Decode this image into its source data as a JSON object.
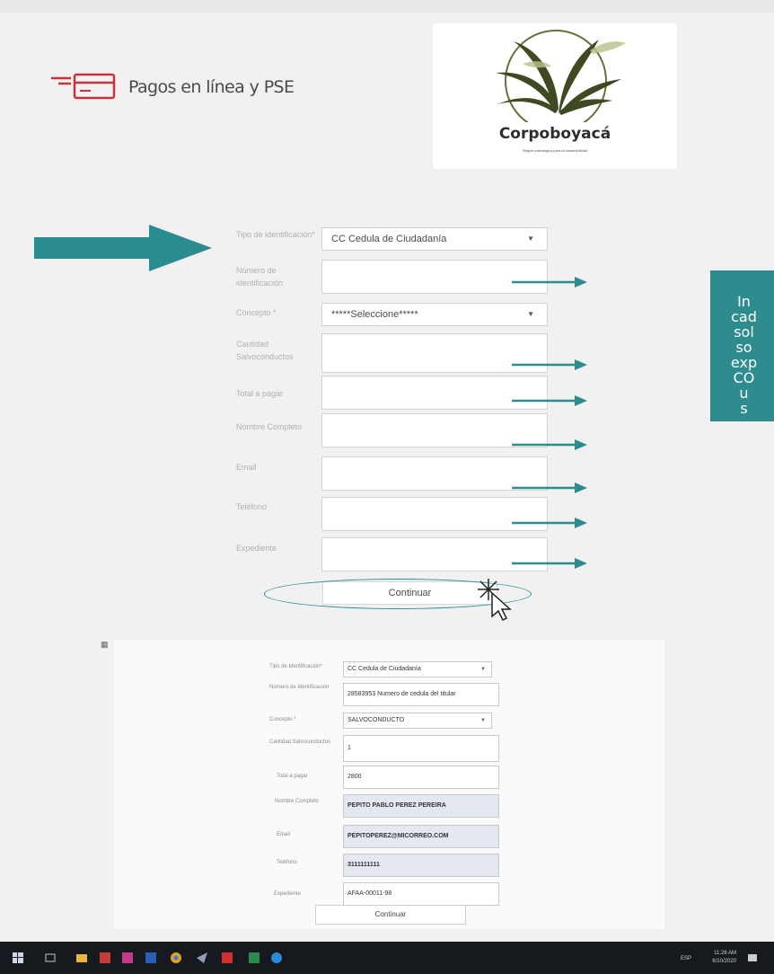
{
  "header": {
    "title": "Pagos en línea y PSE",
    "logo_name": "Corpoboyacá",
    "logo_tagline": "Región estratégica para la sostenibilidad",
    "brand_color": "#c8323c"
  },
  "form_top": {
    "fields": [
      {
        "label": "Tipo de identificación*",
        "value": "CC Cedula de Ciudadanía",
        "type": "select"
      },
      {
        "label": "Número de identificación",
        "value": "",
        "type": "text"
      },
      {
        "label": "Concepto *",
        "value": "*****Seleccione*****",
        "type": "select"
      },
      {
        "label": "Cantidad Salvoconductos",
        "value": "",
        "type": "text"
      },
      {
        "label": "Total a pagar",
        "value": "",
        "type": "text"
      },
      {
        "label": "Nombre Completo",
        "value": "",
        "type": "text"
      },
      {
        "label": "Email",
        "value": "",
        "type": "text"
      },
      {
        "label": "Teléfono",
        "value": "",
        "type": "text"
      },
      {
        "label": "Expediente",
        "value": "",
        "type": "text"
      }
    ],
    "continue_label": "Continuar"
  },
  "callout": {
    "text": "In\ncad\nsol\nso\nexp\nCO\nu\ns",
    "color": "#2e8c8e"
  },
  "form_bottom": {
    "fields": [
      {
        "label": "Tipo de Identificación*",
        "value": "CC Cedula de Ciudadanía",
        "type": "select"
      },
      {
        "label": "Número de Identificación",
        "value": "28583953 Numero de cedula del titular",
        "type": "text"
      },
      {
        "label": "Concepto *",
        "value": "SALVOCONDUCTO",
        "type": "select"
      },
      {
        "label": "Cantidad Salvoconductos",
        "value": "1",
        "type": "text"
      },
      {
        "label": "Total a pagar",
        "value": "2800",
        "type": "text"
      },
      {
        "label": "Nombre Completo",
        "value": "PEPITO PABLO PEREZ PEREIRA",
        "type": "text"
      },
      {
        "label": "Email",
        "value": "PEPITOPEREZ@MICORREO.COM",
        "type": "text"
      },
      {
        "label": "Teléfono",
        "value": "3111111111",
        "type": "text"
      },
      {
        "label": "Expediente",
        "value": "AFAA-00011-98",
        "type": "text"
      }
    ],
    "continue_label": "Continuar"
  },
  "taskbar": {
    "time": "11:26 AM",
    "date": "6/10/2020",
    "language": "ESP"
  }
}
